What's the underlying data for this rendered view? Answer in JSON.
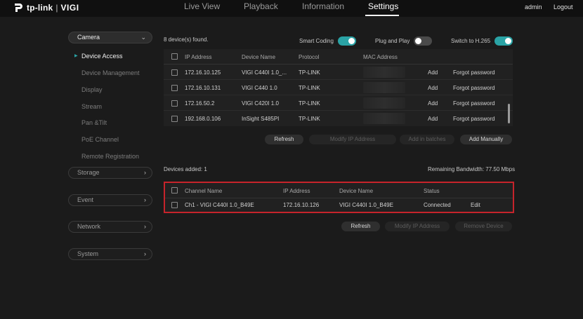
{
  "header": {
    "logo_text": "tp-link",
    "logo_sep": "|",
    "logo_product": "VIGI",
    "nav": [
      "Live View",
      "Playback",
      "Information",
      "Settings"
    ],
    "active_nav": "Settings",
    "user": "admin",
    "logout": "Logout"
  },
  "sidebar": {
    "camera": "Camera",
    "camera_items": [
      "Device Access",
      "Device Management",
      "Display",
      "Stream",
      "Pan &Tilt",
      "PoE Channel",
      "Remote Registration"
    ],
    "active_item": "Device Access",
    "groups": [
      "Storage",
      "Event",
      "Network",
      "System"
    ]
  },
  "discovered": {
    "count_text": "8 device(s) found.",
    "smart_coding": {
      "label": "Smart Coding",
      "on": true
    },
    "plug_and_play": {
      "label": "Plug and Play",
      "on": false
    },
    "switch_h265": {
      "label": "Switch to H.265",
      "on": true
    },
    "columns": [
      "IP Address",
      "Device Name",
      "Protocol",
      "MAC Address"
    ],
    "rows": [
      {
        "ip": "172.16.10.125",
        "name": "VIGI C440I 1.0_...",
        "protocol": "TP-LINK",
        "action": "Add",
        "forgot": "Forgot password"
      },
      {
        "ip": "172.16.10.131",
        "name": "VIGI C440 1.0",
        "protocol": "TP-LINK",
        "action": "Add",
        "forgot": "Forgot password"
      },
      {
        "ip": "172.16.50.2",
        "name": "VIGI C420I 1.0",
        "protocol": "TP-LINK",
        "action": "Add",
        "forgot": "Forgot password"
      },
      {
        "ip": "192.168.0.106",
        "name": "InSight S485PI",
        "protocol": "TP-LINK",
        "action": "Add",
        "forgot": "Forgot password"
      }
    ],
    "buttons": {
      "refresh": "Refresh",
      "modify_ip": "Modify IP Address",
      "add_batches": "Add in batches",
      "add_manually": "Add Manually"
    }
  },
  "added": {
    "title": "Devices added: 1",
    "bandwidth": "Remaining Bandwidth: 77.50 Mbps",
    "columns": [
      "Channel Name",
      "IP Address",
      "Device Name",
      "Status"
    ],
    "rows": [
      {
        "channel": "Ch1 - VIGI C440I 1.0_B49E",
        "ip": "172.16.10.126",
        "name": "VIGI C440I 1.0_B49E",
        "status": "Connected",
        "edit": "Edit"
      }
    ],
    "buttons": {
      "refresh": "Refresh",
      "modify_ip": "Modify IP Address",
      "remove": "Remove Device"
    }
  },
  "colors": {
    "accent": "#2aa3a5",
    "highlight": "#c6242b",
    "background": "#1b1b1b"
  }
}
